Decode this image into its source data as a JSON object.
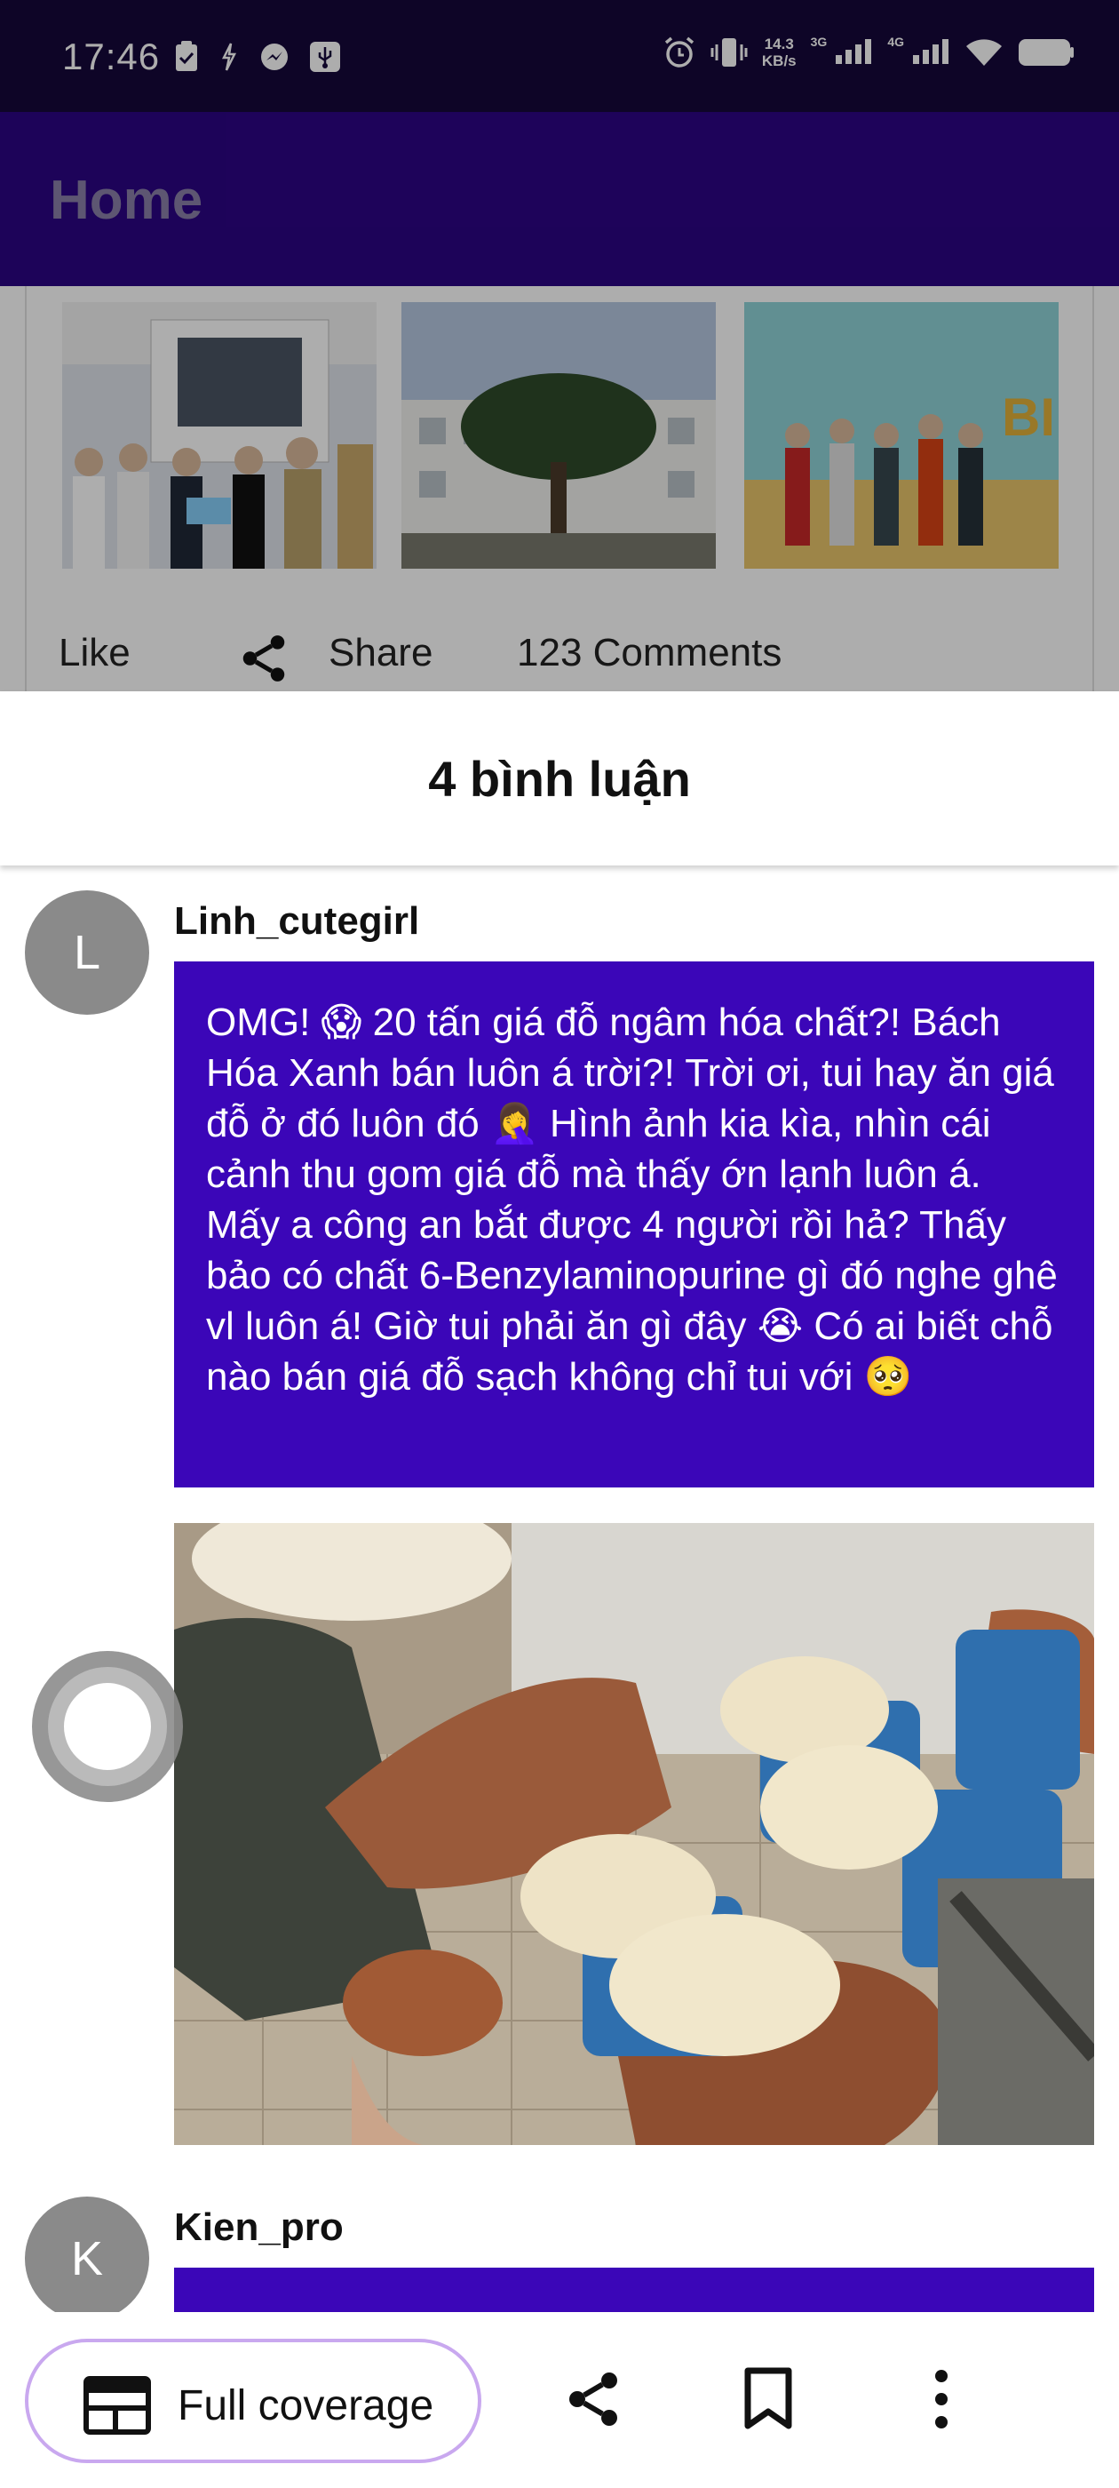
{
  "status_bar": {
    "time": "17:46",
    "net_speed_value": "14.3",
    "net_speed_unit": "KB/s",
    "signal_1": "3G",
    "signal_2": "4G"
  },
  "app_bar": {
    "title": "Home"
  },
  "feed_card": {
    "like_label": "Like",
    "share_label": "Share",
    "comments_label": "123 Comments"
  },
  "sheet": {
    "title": "4 bình luận"
  },
  "comments": [
    {
      "avatar_letter": "L",
      "username": "Linh_cutegirl",
      "text": "OMG! 😱 20 tấn giá đỗ ngâm hóa chất?! Bách Hóa Xanh bán luôn á trời?!  Trời ơi, tui hay ăn giá đỗ ở đó luôn đó 🤦‍♀️  Hình ảnh kia kìa, nhìn cái cảnh thu gom giá đỗ mà thấy ớn lạnh luôn á.  Mấy a công an bắt được 4 người rồi hả?  Thấy bảo có chất 6-Benzylaminopurine gì đó nghe ghê vl luôn á!  Giờ tui phải ăn gì đây 😭  Có ai biết chỗ nào bán giá đỗ sạch không chỉ tui với 🥺"
    },
    {
      "avatar_letter": "K",
      "username": "Kien_pro"
    }
  ],
  "bottom_bar": {
    "full_coverage_label": "Full coverage"
  },
  "colors": {
    "status_bar": "#15083a",
    "app_bar": "#2c0584",
    "bubble": "#3b06b8",
    "pill_border": "#c9a8ef"
  }
}
